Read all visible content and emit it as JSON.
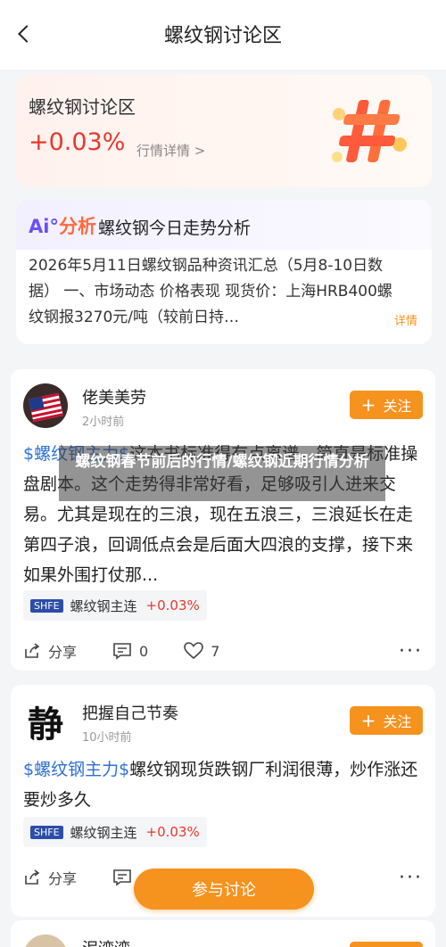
{
  "header": {
    "title": "螺纹钢讨论区"
  },
  "hero": {
    "name": "螺纹钢讨论区",
    "change": "+0.03%",
    "link_label": "行情详情 >",
    "colors": {
      "up": "#e8372b",
      "accent": "#f6921e"
    }
  },
  "ai": {
    "logo_prefix": "Ai°",
    "logo_label": "分析",
    "title": "螺纹钢今日走势分析",
    "body": "2026年5月11日螺纹钢品种资讯汇总（5月8-10日数据） 一、市场动态 价格表现 现货价：上海HRB400螺纹钢报3270元/吨（较前日持…",
    "more_label": "详情"
  },
  "overlay": {
    "text": "螺纹钢春节前后的行情/螺纹钢近期行情分析"
  },
  "posts": [
    {
      "username": "佬美美劳",
      "time": "2小时前",
      "follow_label": "关注",
      "tag": "$螺纹钢主力$",
      "text": "这本书标准得有点离谱，简直是标准操盘剧本。这个走势得非常好看，足够吸引人进来交易。尤其是现在的三浪，现在五浪三，三浪延长在走第四子浪，回调低点会是后面大四浪的支撑，接下来如果外围打仗那...",
      "stock": {
        "exchange": "SHFE",
        "name": "螺纹钢主连",
        "change": "+0.03%"
      },
      "share_label": "分享",
      "comments": "0",
      "likes": "7"
    },
    {
      "username": "把握自己节奏",
      "avatar_char": "静",
      "time": "10小时前",
      "follow_label": "关注",
      "tag": "$螺纹钢主力$",
      "text": "螺纹钢现货跌钢厂利润很薄，炒作涨还要炒多久",
      "stock": {
        "exchange": "SHFE",
        "name": "螺纹钢主连",
        "change": "+0.03%"
      },
      "share_label": "分享"
    },
    {
      "username": "泥湾湾",
      "follow_label": "关注"
    }
  ],
  "fab": {
    "label": "参与讨论"
  }
}
